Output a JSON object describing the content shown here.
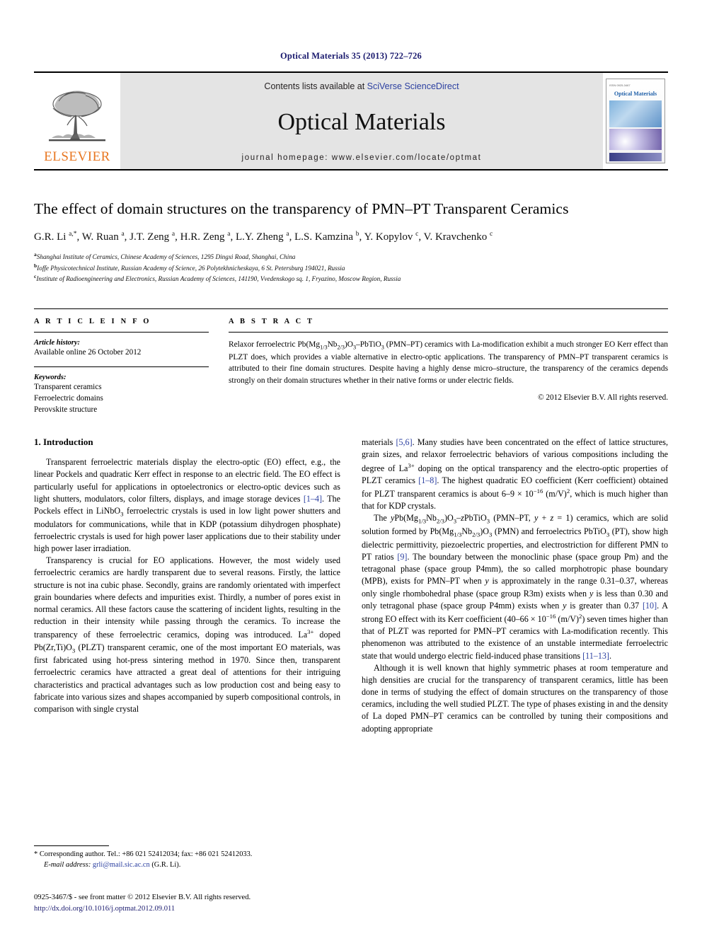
{
  "running_head": "Optical Materials 35 (2013) 722–726",
  "masthead": {
    "contents_prefix": "Contents lists available at ",
    "sciencedirect_link": "SciVerse ScienceDirect",
    "journal_name": "Optical Materials",
    "homepage": "journal homepage: www.elsevier.com/locate/optmat",
    "publisher": "ELSEVIER",
    "cover_title": "Optical Materials",
    "cover_kicker": "ISSN 0925-3467"
  },
  "article": {
    "title": "The effect of domain structures on the transparency of PMN–PT Transparent Ceramics",
    "authors_html": "G.R. Li <sup>a,</sup><sup>*</sup>, W. Ruan <sup>a</sup>, J.T. Zeng <sup>a</sup>, H.R. Zeng <sup>a</sup>, L.Y. Zheng <sup>a</sup>, L.S. Kamzina <sup>b</sup>, Y. Kopylov <sup>c</sup>, V. Kravchenko <sup>c</sup>",
    "affiliations": [
      {
        "marker": "a",
        "text": "Shanghai Institute of Ceramics, Chinese Academy of Sciences, 1295 Dingxi Road, Shanghai, China"
      },
      {
        "marker": "b",
        "text": "Ioffe Physicotechnical Institute, Russian Academy of Science, 26 Polytekhnicheskaya, 6 St. Petersburg 194021, Russia"
      },
      {
        "marker": "c",
        "text": "Institute of Radioengineering and Electronics, Russian Academy of Sciences, 141190, Vvedenskogo sq. 1, Fryazino, Moscow Region, Russia"
      }
    ]
  },
  "article_info": {
    "heading": "A R T I C L E    I N F O",
    "history_label": "Article history:",
    "history_value": "Available online 26 October 2012",
    "keywords_label": "Keywords:",
    "keywords": [
      "Transparent ceramics",
      "Ferroelectric domains",
      "Perovskite structure"
    ]
  },
  "abstract": {
    "heading": "A B S T R A C T",
    "body_html": "Relaxor ferroelectric Pb(Mg<sub>1/3</sub>Nb<sub>2/3</sub>)O<sub>3</sub>–PbTiO<sub>3</sub> (PMN–PT) ceramics with La-modification exhibit a much stronger EO Kerr effect than PLZT does, which provides a viable alternative in electro-optic applications. The transparency of PMN–PT transparent ceramics is attributed to their fine domain structures. Despite having a highly dense micro–structure, the transparency of the ceramics depends strongly on their domain structures whether in their native forms or under electric fields.",
    "copyright": "© 2012 Elsevier B.V. All rights reserved."
  },
  "body": {
    "section_title": "1. Introduction",
    "left_paragraphs_html": [
      "Transparent ferroelectric materials display the electro-optic (EO) effect, e.g., the linear Pockels and quadratic Kerr effect in response to an electric field. The EO effect is particularly useful for applications in optoelectronics or electro-optic devices such as light shutters, modulators, color filters, displays, and image storage devices <span class=\"lnk\">[1–4]</span>. The Pockels effect in LiNbO<sub>3</sub> ferroelectric crystals is used in low light power shutters and modulators for communications, while that in KDP (potassium dihydrogen phosphate) ferroelectric crystals is used for high power laser applications due to their stability under high power laser irradiation.",
      "Transparency is crucial for EO applications. However, the most widely used ferroelectric ceramics are hardly transparent due to several reasons. Firstly, the lattice structure is not ina cubic phase. Secondly, grains are randomly orientated with imperfect grain boundaries where defects and impurities exist. Thirdly, a number of pores exist in normal ceramics. All these factors cause the scattering of incident lights, resulting in the reduction in their intensity while passing through the ceramics. To increase the transparency of these ferroelectric ceramics, doping was introduced. La<sup>3+</sup> doped Pb(Zr,Ti)O<sub>3</sub> (PLZT) transparent ceramic, one of the most important EO materials, was first fabricated using hot-press sintering method in 1970. Since then, transparent ferroelectric ceramics have attracted a great deal of attentions for their intriguing characteristics and practical advantages such as low production cost and being easy to fabricate into various sizes and shapes accompanied by superb compositional controls, in comparison with single crystal"
    ],
    "right_paragraphs_html": [
      "materials <span class=\"lnk\">[5,6]</span>. Many studies have been concentrated on the effect of lattice structures, grain sizes, and relaxor ferroelectric behaviors of various compositions including the degree of La<sup>3+</sup> doping on the optical transparency and the electro-optic properties of PLZT ceramics <span class=\"lnk\">[1–8]</span>. The highest quadratic EO coefficient (Kerr coefficient) obtained for PLZT transparent ceramics is about 6–9 × 10<sup>−16</sup> (m/V)<sup>2</sup>, which is much higher than that for KDP crystals.",
      "The <i>y</i>Pb(Mg<sub>1/3</sub>Nb<sub>2/3</sub>)O<sub>3</sub>–<i>z</i>PbTiO<sub>3</sub> (PMN–PT, <i>y</i> + <i>z</i> = 1) ceramics, which are solid solution formed by Pb(Mg<sub>1/3</sub>Nb<sub>2/3</sub>)O<sub>3</sub> (PMN) and ferroelectrics PbTiO<sub>3</sub> (PT), show high dielectric permittivity, piezoelectric properties, and electrostriction for different PMN to PT ratios <span class=\"lnk\">[9]</span>. The boundary between the monoclinic phase (space group Pm) and the tetragonal phase (space group P4mm), the so called morphotropic phase boundary (MPB), exists for PMN–PT when <i>y</i> is approximately in the range 0.31–0.37, whereas only single rhombohedral phase (space group R3m) exists when <i>y</i> is less than 0.30 and only tetragonal phase (space group P4mm) exists when <i>y</i> is greater than 0.37 <span class=\"lnk\">[10]</span>. A strong EO effect with its Kerr coefficient (40–66 × 10<sup>−16</sup> (m/V)<sup>2</sup>) seven times higher than that of PLZT was reported for PMN–PT ceramics with La-modification recently. This phenomenon was attributed to the existence of an unstable intermediate ferroelectric state that would undergo electric field-induced phase transitions <span class=\"lnk\">[11–13]</span>.",
      "Although it is well known that highly symmetric phases at room temperature and high densities are crucial for the transparency of transparent ceramics, little has been done in terms of studying the effect of domain structures on the transparency of those ceramics, including the well studied PLZT. The type of phases existing in and the density of La doped PMN–PT ceramics can be controlled by tuning their compositions and adopting appropriate"
    ]
  },
  "footnote": {
    "star": "*",
    "corresponding_html": "Corresponding author. Tel.: +86 021 52412034; fax: +86 021 52412033.",
    "email_label": "E-mail address:",
    "email": "grli@mail.sic.ac.cn",
    "email_owner": "(G.R. Li)."
  },
  "page_footer": {
    "issn_line": "0925-3467/$ - see front matter © 2012 Elsevier B.V. All rights reserved.",
    "doi": "http://dx.doi.org/10.1016/j.optmat.2012.09.011"
  },
  "colors": {
    "link": "#2b3fa0",
    "running_head": "#1a1a6e",
    "elsevier_orange": "#e87722",
    "masthead_grey": "#e4e4e4"
  }
}
